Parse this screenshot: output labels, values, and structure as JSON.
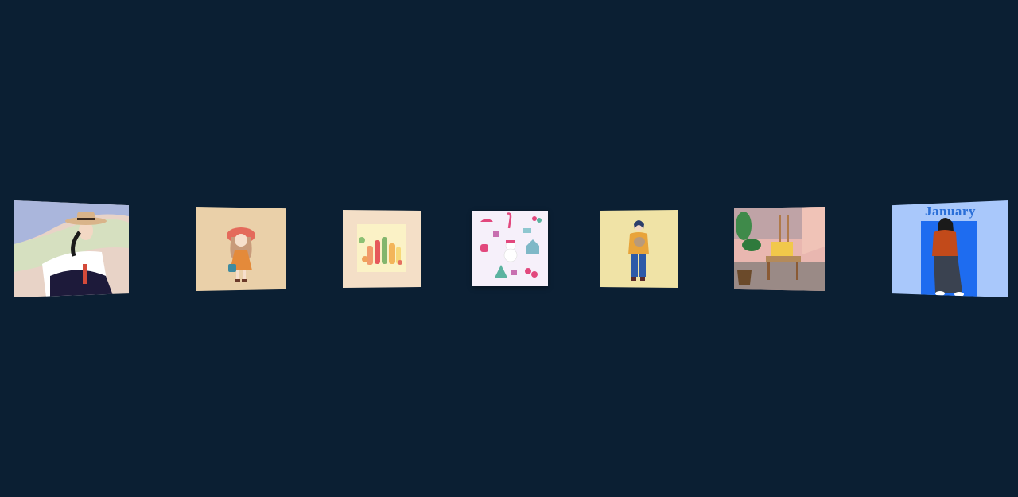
{
  "carousel": {
    "cards": [
      {
        "subject": "woman-in-straw-hat",
        "bg": "#e8d3c7"
      },
      {
        "subject": "girl-in-red-hat",
        "bg": "#ead0a9"
      },
      {
        "subject": "bottles-still-life",
        "bg": "#f4dfc7"
      },
      {
        "subject": "christmas-pattern",
        "bg": "#f6f0fa"
      },
      {
        "subject": "woman-holding-cat",
        "bg": "#f0e3a6"
      },
      {
        "subject": "easel-and-plant-room",
        "bg": "#e9b7b0"
      },
      {
        "subject": "january-poster",
        "bg": "#a9c8fb",
        "title": "January"
      }
    ]
  },
  "colors": {
    "background": "#0b1f33",
    "january_blue": "#1e6cf0"
  }
}
